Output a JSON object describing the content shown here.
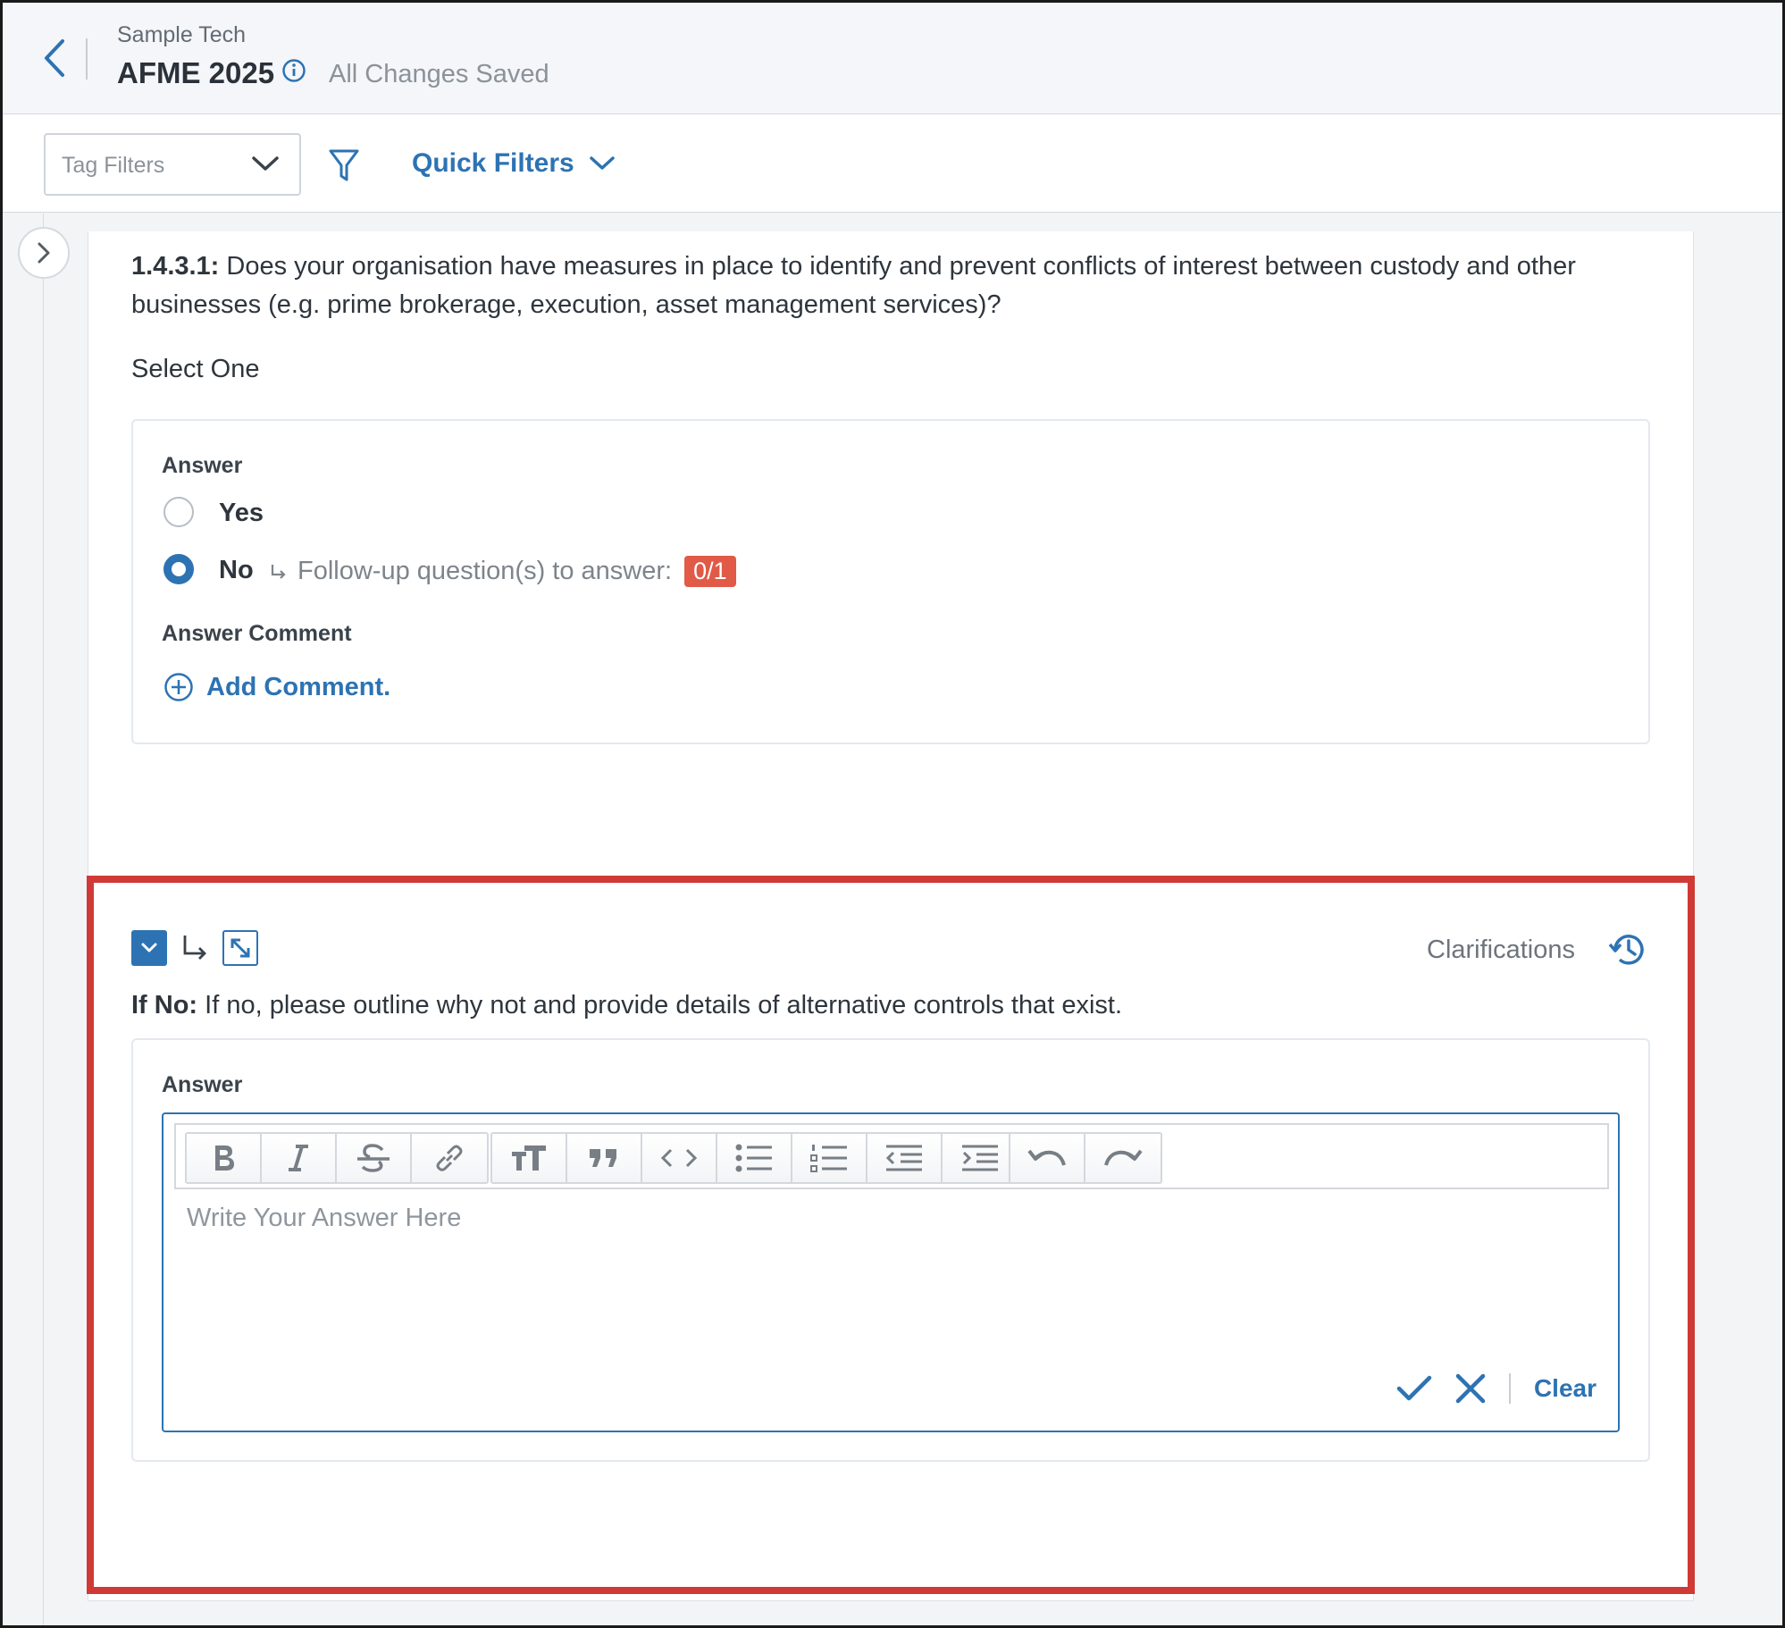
{
  "header": {
    "org_name": "Sample Tech",
    "project_title": "AFME 2025",
    "save_status": "All Changes Saved"
  },
  "filters": {
    "tag_filter_placeholder": "Tag Filters",
    "quick_filters_label": "Quick Filters"
  },
  "question": {
    "number": "1.4.3.1:",
    "text": " Does your organisation have measures in place to identify and prevent conflicts of interest between custody and other businesses (e.g. prime brokerage, execution, asset management services)?",
    "instruction": "Select One",
    "answer_label": "Answer",
    "options": [
      {
        "label": "Yes",
        "selected": false
      },
      {
        "label": "No",
        "selected": true
      }
    ],
    "followup_text": "Follow-up question(s) to answer:",
    "followup_badge": "0/1",
    "comment_label": "Answer Comment",
    "add_comment_label": "Add Comment."
  },
  "followup": {
    "clarifications_label": "Clarifications",
    "condition": "If No:",
    "text": " If no, please outline why not and provide details of alternative controls that exist.",
    "answer_label": "Answer",
    "editor_placeholder": "Write Your Answer Here",
    "clear_label": "Clear",
    "toolbar": [
      "bold-icon",
      "italic-icon",
      "strikethrough-icon",
      "link-icon",
      "heading-icon",
      "quote-icon",
      "code-icon",
      "bullet-list-icon",
      "numbered-list-icon",
      "outdent-icon",
      "indent-icon",
      "undo-icon",
      "redo-icon"
    ]
  },
  "colors": {
    "accent": "#2d73b3",
    "badge": "#e05a47",
    "highlight_border": "#cf3a36"
  }
}
